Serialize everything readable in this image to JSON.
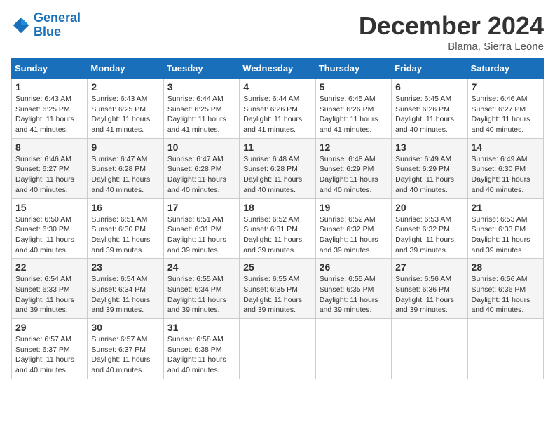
{
  "header": {
    "logo_line1": "General",
    "logo_line2": "Blue",
    "month_title": "December 2024",
    "location": "Blama, Sierra Leone"
  },
  "weekdays": [
    "Sunday",
    "Monday",
    "Tuesday",
    "Wednesday",
    "Thursday",
    "Friday",
    "Saturday"
  ],
  "weeks": [
    [
      {
        "day": "1",
        "info": "Sunrise: 6:43 AM\nSunset: 6:25 PM\nDaylight: 11 hours and 41 minutes."
      },
      {
        "day": "2",
        "info": "Sunrise: 6:43 AM\nSunset: 6:25 PM\nDaylight: 11 hours and 41 minutes."
      },
      {
        "day": "3",
        "info": "Sunrise: 6:44 AM\nSunset: 6:25 PM\nDaylight: 11 hours and 41 minutes."
      },
      {
        "day": "4",
        "info": "Sunrise: 6:44 AM\nSunset: 6:26 PM\nDaylight: 11 hours and 41 minutes."
      },
      {
        "day": "5",
        "info": "Sunrise: 6:45 AM\nSunset: 6:26 PM\nDaylight: 11 hours and 41 minutes."
      },
      {
        "day": "6",
        "info": "Sunrise: 6:45 AM\nSunset: 6:26 PM\nDaylight: 11 hours and 40 minutes."
      },
      {
        "day": "7",
        "info": "Sunrise: 6:46 AM\nSunset: 6:27 PM\nDaylight: 11 hours and 40 minutes."
      }
    ],
    [
      {
        "day": "8",
        "info": "Sunrise: 6:46 AM\nSunset: 6:27 PM\nDaylight: 11 hours and 40 minutes."
      },
      {
        "day": "9",
        "info": "Sunrise: 6:47 AM\nSunset: 6:28 PM\nDaylight: 11 hours and 40 minutes."
      },
      {
        "day": "10",
        "info": "Sunrise: 6:47 AM\nSunset: 6:28 PM\nDaylight: 11 hours and 40 minutes."
      },
      {
        "day": "11",
        "info": "Sunrise: 6:48 AM\nSunset: 6:28 PM\nDaylight: 11 hours and 40 minutes."
      },
      {
        "day": "12",
        "info": "Sunrise: 6:48 AM\nSunset: 6:29 PM\nDaylight: 11 hours and 40 minutes."
      },
      {
        "day": "13",
        "info": "Sunrise: 6:49 AM\nSunset: 6:29 PM\nDaylight: 11 hours and 40 minutes."
      },
      {
        "day": "14",
        "info": "Sunrise: 6:49 AM\nSunset: 6:30 PM\nDaylight: 11 hours and 40 minutes."
      }
    ],
    [
      {
        "day": "15",
        "info": "Sunrise: 6:50 AM\nSunset: 6:30 PM\nDaylight: 11 hours and 40 minutes."
      },
      {
        "day": "16",
        "info": "Sunrise: 6:51 AM\nSunset: 6:30 PM\nDaylight: 11 hours and 39 minutes."
      },
      {
        "day": "17",
        "info": "Sunrise: 6:51 AM\nSunset: 6:31 PM\nDaylight: 11 hours and 39 minutes."
      },
      {
        "day": "18",
        "info": "Sunrise: 6:52 AM\nSunset: 6:31 PM\nDaylight: 11 hours and 39 minutes."
      },
      {
        "day": "19",
        "info": "Sunrise: 6:52 AM\nSunset: 6:32 PM\nDaylight: 11 hours and 39 minutes."
      },
      {
        "day": "20",
        "info": "Sunrise: 6:53 AM\nSunset: 6:32 PM\nDaylight: 11 hours and 39 minutes."
      },
      {
        "day": "21",
        "info": "Sunrise: 6:53 AM\nSunset: 6:33 PM\nDaylight: 11 hours and 39 minutes."
      }
    ],
    [
      {
        "day": "22",
        "info": "Sunrise: 6:54 AM\nSunset: 6:33 PM\nDaylight: 11 hours and 39 minutes."
      },
      {
        "day": "23",
        "info": "Sunrise: 6:54 AM\nSunset: 6:34 PM\nDaylight: 11 hours and 39 minutes."
      },
      {
        "day": "24",
        "info": "Sunrise: 6:55 AM\nSunset: 6:34 PM\nDaylight: 11 hours and 39 minutes."
      },
      {
        "day": "25",
        "info": "Sunrise: 6:55 AM\nSunset: 6:35 PM\nDaylight: 11 hours and 39 minutes."
      },
      {
        "day": "26",
        "info": "Sunrise: 6:55 AM\nSunset: 6:35 PM\nDaylight: 11 hours and 39 minutes."
      },
      {
        "day": "27",
        "info": "Sunrise: 6:56 AM\nSunset: 6:36 PM\nDaylight: 11 hours and 39 minutes."
      },
      {
        "day": "28",
        "info": "Sunrise: 6:56 AM\nSunset: 6:36 PM\nDaylight: 11 hours and 40 minutes."
      }
    ],
    [
      {
        "day": "29",
        "info": "Sunrise: 6:57 AM\nSunset: 6:37 PM\nDaylight: 11 hours and 40 minutes."
      },
      {
        "day": "30",
        "info": "Sunrise: 6:57 AM\nSunset: 6:37 PM\nDaylight: 11 hours and 40 minutes."
      },
      {
        "day": "31",
        "info": "Sunrise: 6:58 AM\nSunset: 6:38 PM\nDaylight: 11 hours and 40 minutes."
      },
      {
        "day": "",
        "info": ""
      },
      {
        "day": "",
        "info": ""
      },
      {
        "day": "",
        "info": ""
      },
      {
        "day": "",
        "info": ""
      }
    ]
  ]
}
